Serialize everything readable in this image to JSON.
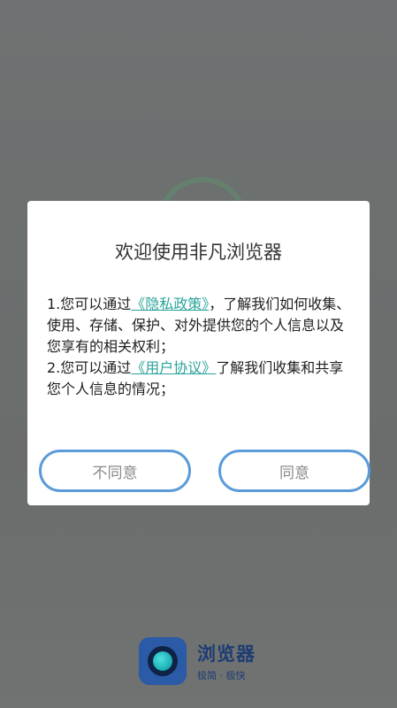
{
  "dialog": {
    "title": "欢迎使用非凡浏览器",
    "paragraph1": {
      "prefix": " 1.您可以通过",
      "link": "《隐私政策》",
      "suffix": "，了解我们如何收集、使用、存储、保护、对外提供您的个人信息以及您享有的相关权利；"
    },
    "paragraph2": {
      "prefix": " 2.您可以通过",
      "link": "《用户协议》",
      "suffix": "了解我们收集和共享您个人信息的情况；"
    },
    "disagree_label": "不同意",
    "agree_label": "同意"
  },
  "brand": {
    "name": "浏览器",
    "slogan": "极简 · 极快"
  },
  "colors": {
    "link": "#2aa59a",
    "button_border": "#5b9bd9",
    "brand": "#1d3c74"
  }
}
